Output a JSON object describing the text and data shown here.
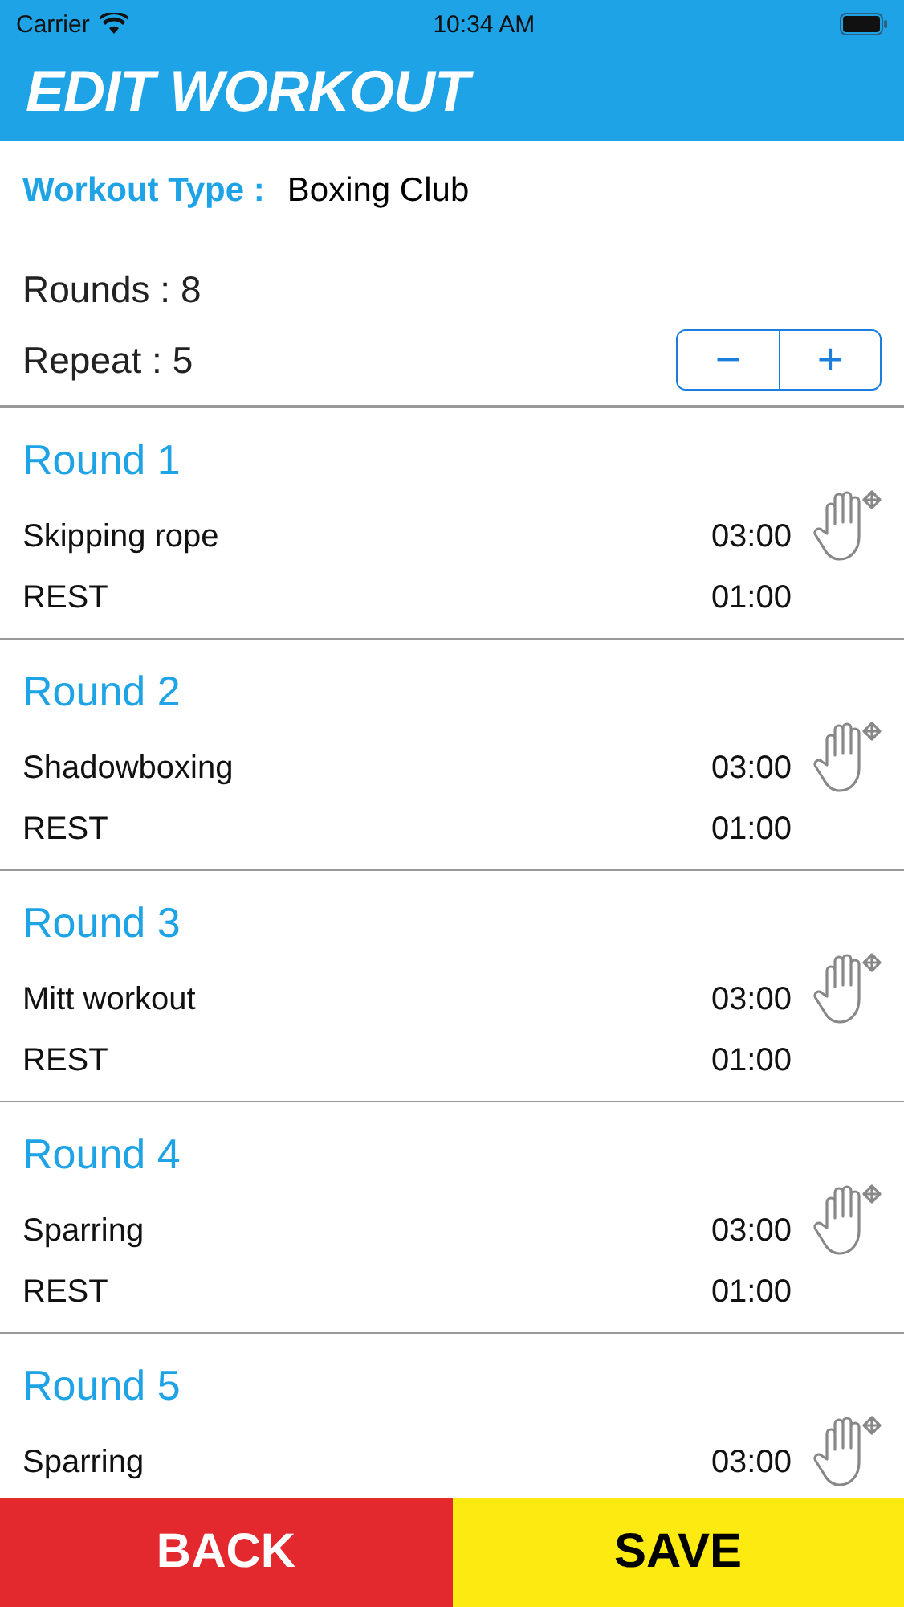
{
  "status_bar": {
    "carrier": "Carrier",
    "time": "10:34 AM"
  },
  "header": {
    "title": "EDIT WORKOUT"
  },
  "workout_type": {
    "label": "Workout Type :",
    "value": "Boxing Club"
  },
  "rounds_count": "Rounds : 8",
  "repeat": {
    "label": "Repeat : 5",
    "decrement": "−",
    "increment": "+"
  },
  "rounds": [
    {
      "title": "Round 1",
      "activities": [
        {
          "name": "Skipping rope",
          "time": "03:00"
        },
        {
          "name": "REST",
          "time": "01:00"
        }
      ]
    },
    {
      "title": "Round 2",
      "activities": [
        {
          "name": "Shadowboxing",
          "time": "03:00"
        },
        {
          "name": "REST",
          "time": "01:00"
        }
      ]
    },
    {
      "title": "Round 3",
      "activities": [
        {
          "name": "Mitt workout",
          "time": "03:00"
        },
        {
          "name": "REST",
          "time": "01:00"
        }
      ]
    },
    {
      "title": "Round 4",
      "activities": [
        {
          "name": "Sparring",
          "time": "03:00"
        },
        {
          "name": "REST",
          "time": "01:00"
        }
      ]
    },
    {
      "title": "Round 5",
      "activities": [
        {
          "name": "Sparring",
          "time": "03:00"
        }
      ]
    }
  ],
  "footer": {
    "back": "BACK",
    "save": "SAVE"
  }
}
